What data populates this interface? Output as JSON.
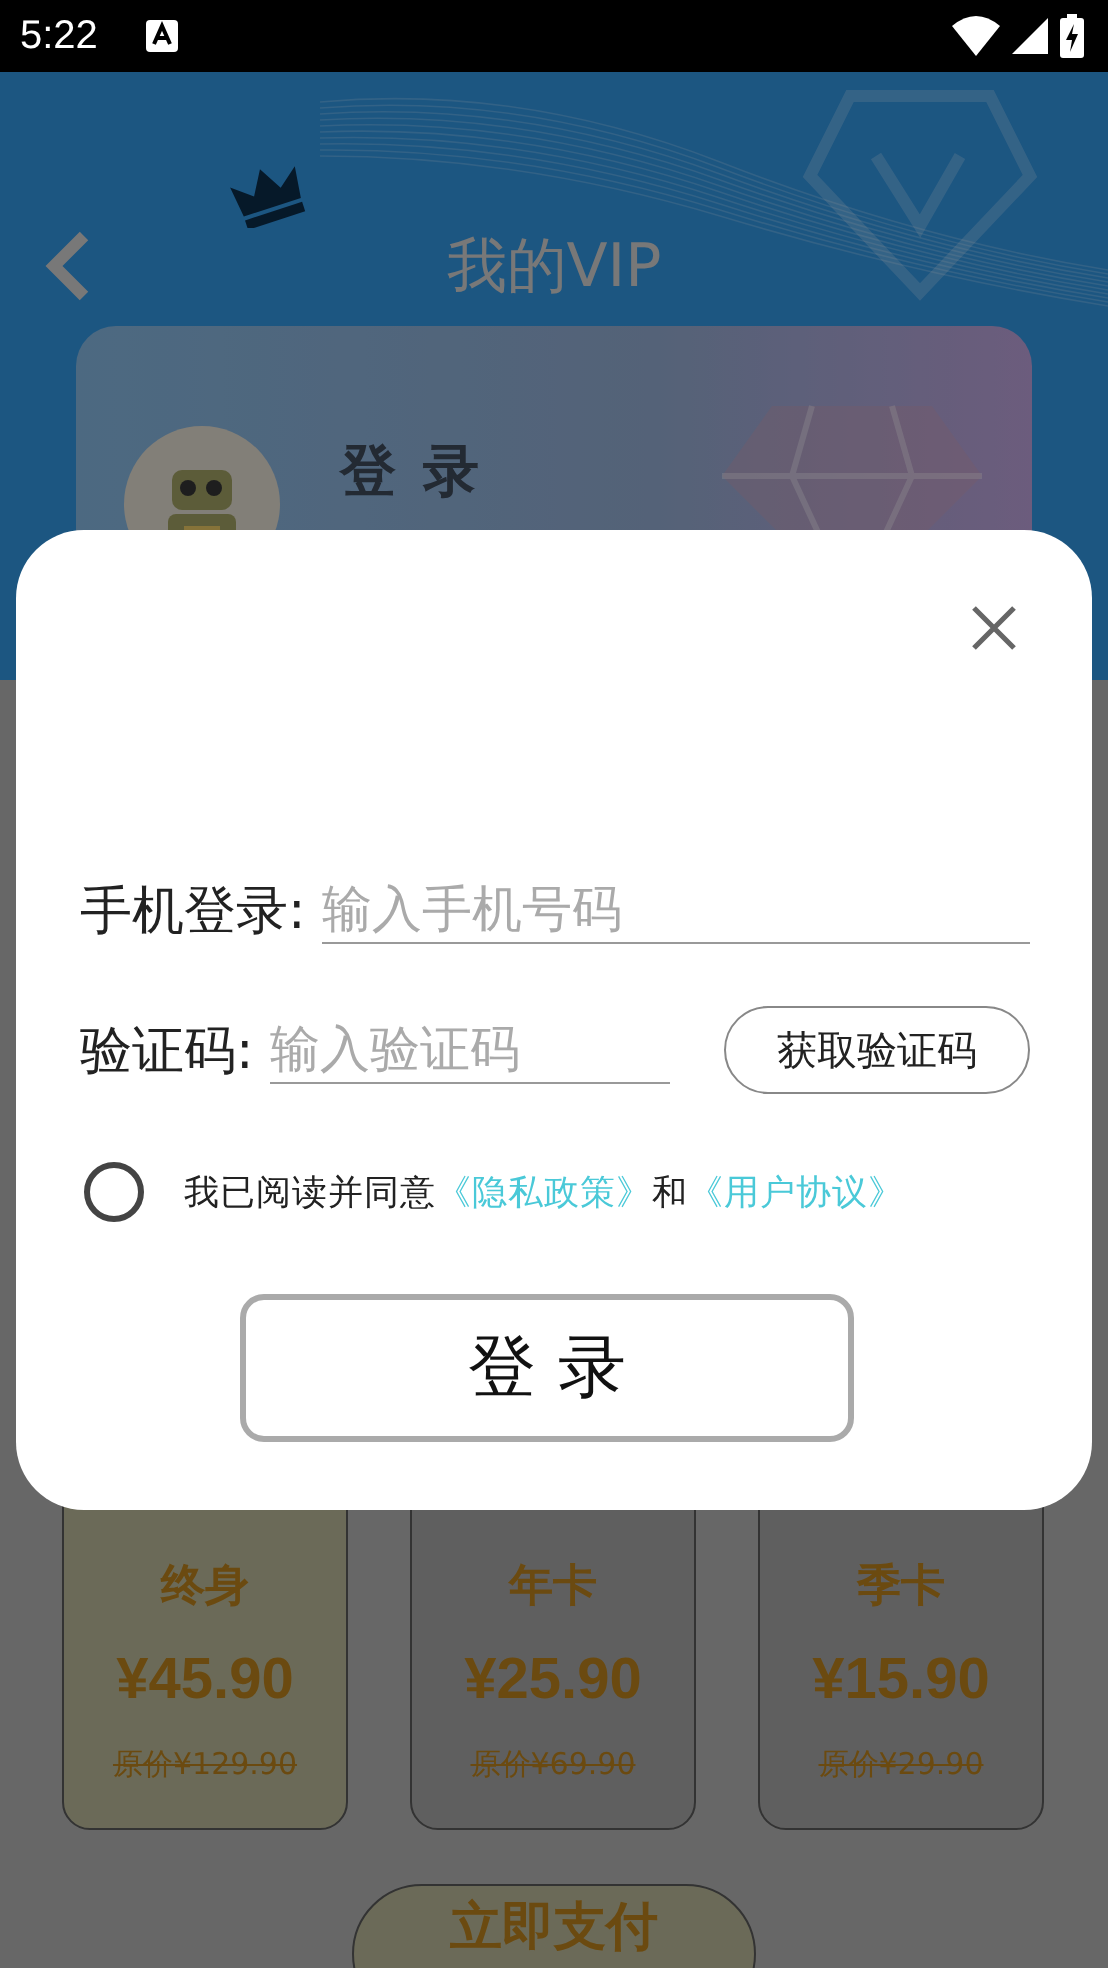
{
  "status_bar": {
    "time": "5:22"
  },
  "header": {
    "title": "我的VIP"
  },
  "profile": {
    "name": "登 录"
  },
  "plans": [
    {
      "name": "终身",
      "price": "¥45.90",
      "original_price": "原价¥129.90",
      "selected": true
    },
    {
      "name": "年卡",
      "price": "¥25.90",
      "original_price": "原价¥69.90",
      "selected": false
    },
    {
      "name": "季卡",
      "price": "¥15.90",
      "original_price": "原价¥29.90",
      "selected": false
    }
  ],
  "pay_button": {
    "label": "立即支付"
  },
  "login_dialog": {
    "fields": [
      {
        "label": "手机登录:",
        "placeholder": "输入手机号码"
      },
      {
        "label": "验证码:",
        "placeholder": "输入验证码",
        "button": "获取验证码"
      }
    ],
    "agreement": {
      "checked": false,
      "parts": [
        {
          "kind": "plain",
          "text": "我已阅读并同意"
        },
        {
          "kind": "link",
          "text": "《隐私政策》"
        },
        {
          "kind": "plain",
          "text": "和"
        },
        {
          "kind": "link",
          "text": "《用户协议》"
        }
      ]
    },
    "submit": "登 录"
  }
}
